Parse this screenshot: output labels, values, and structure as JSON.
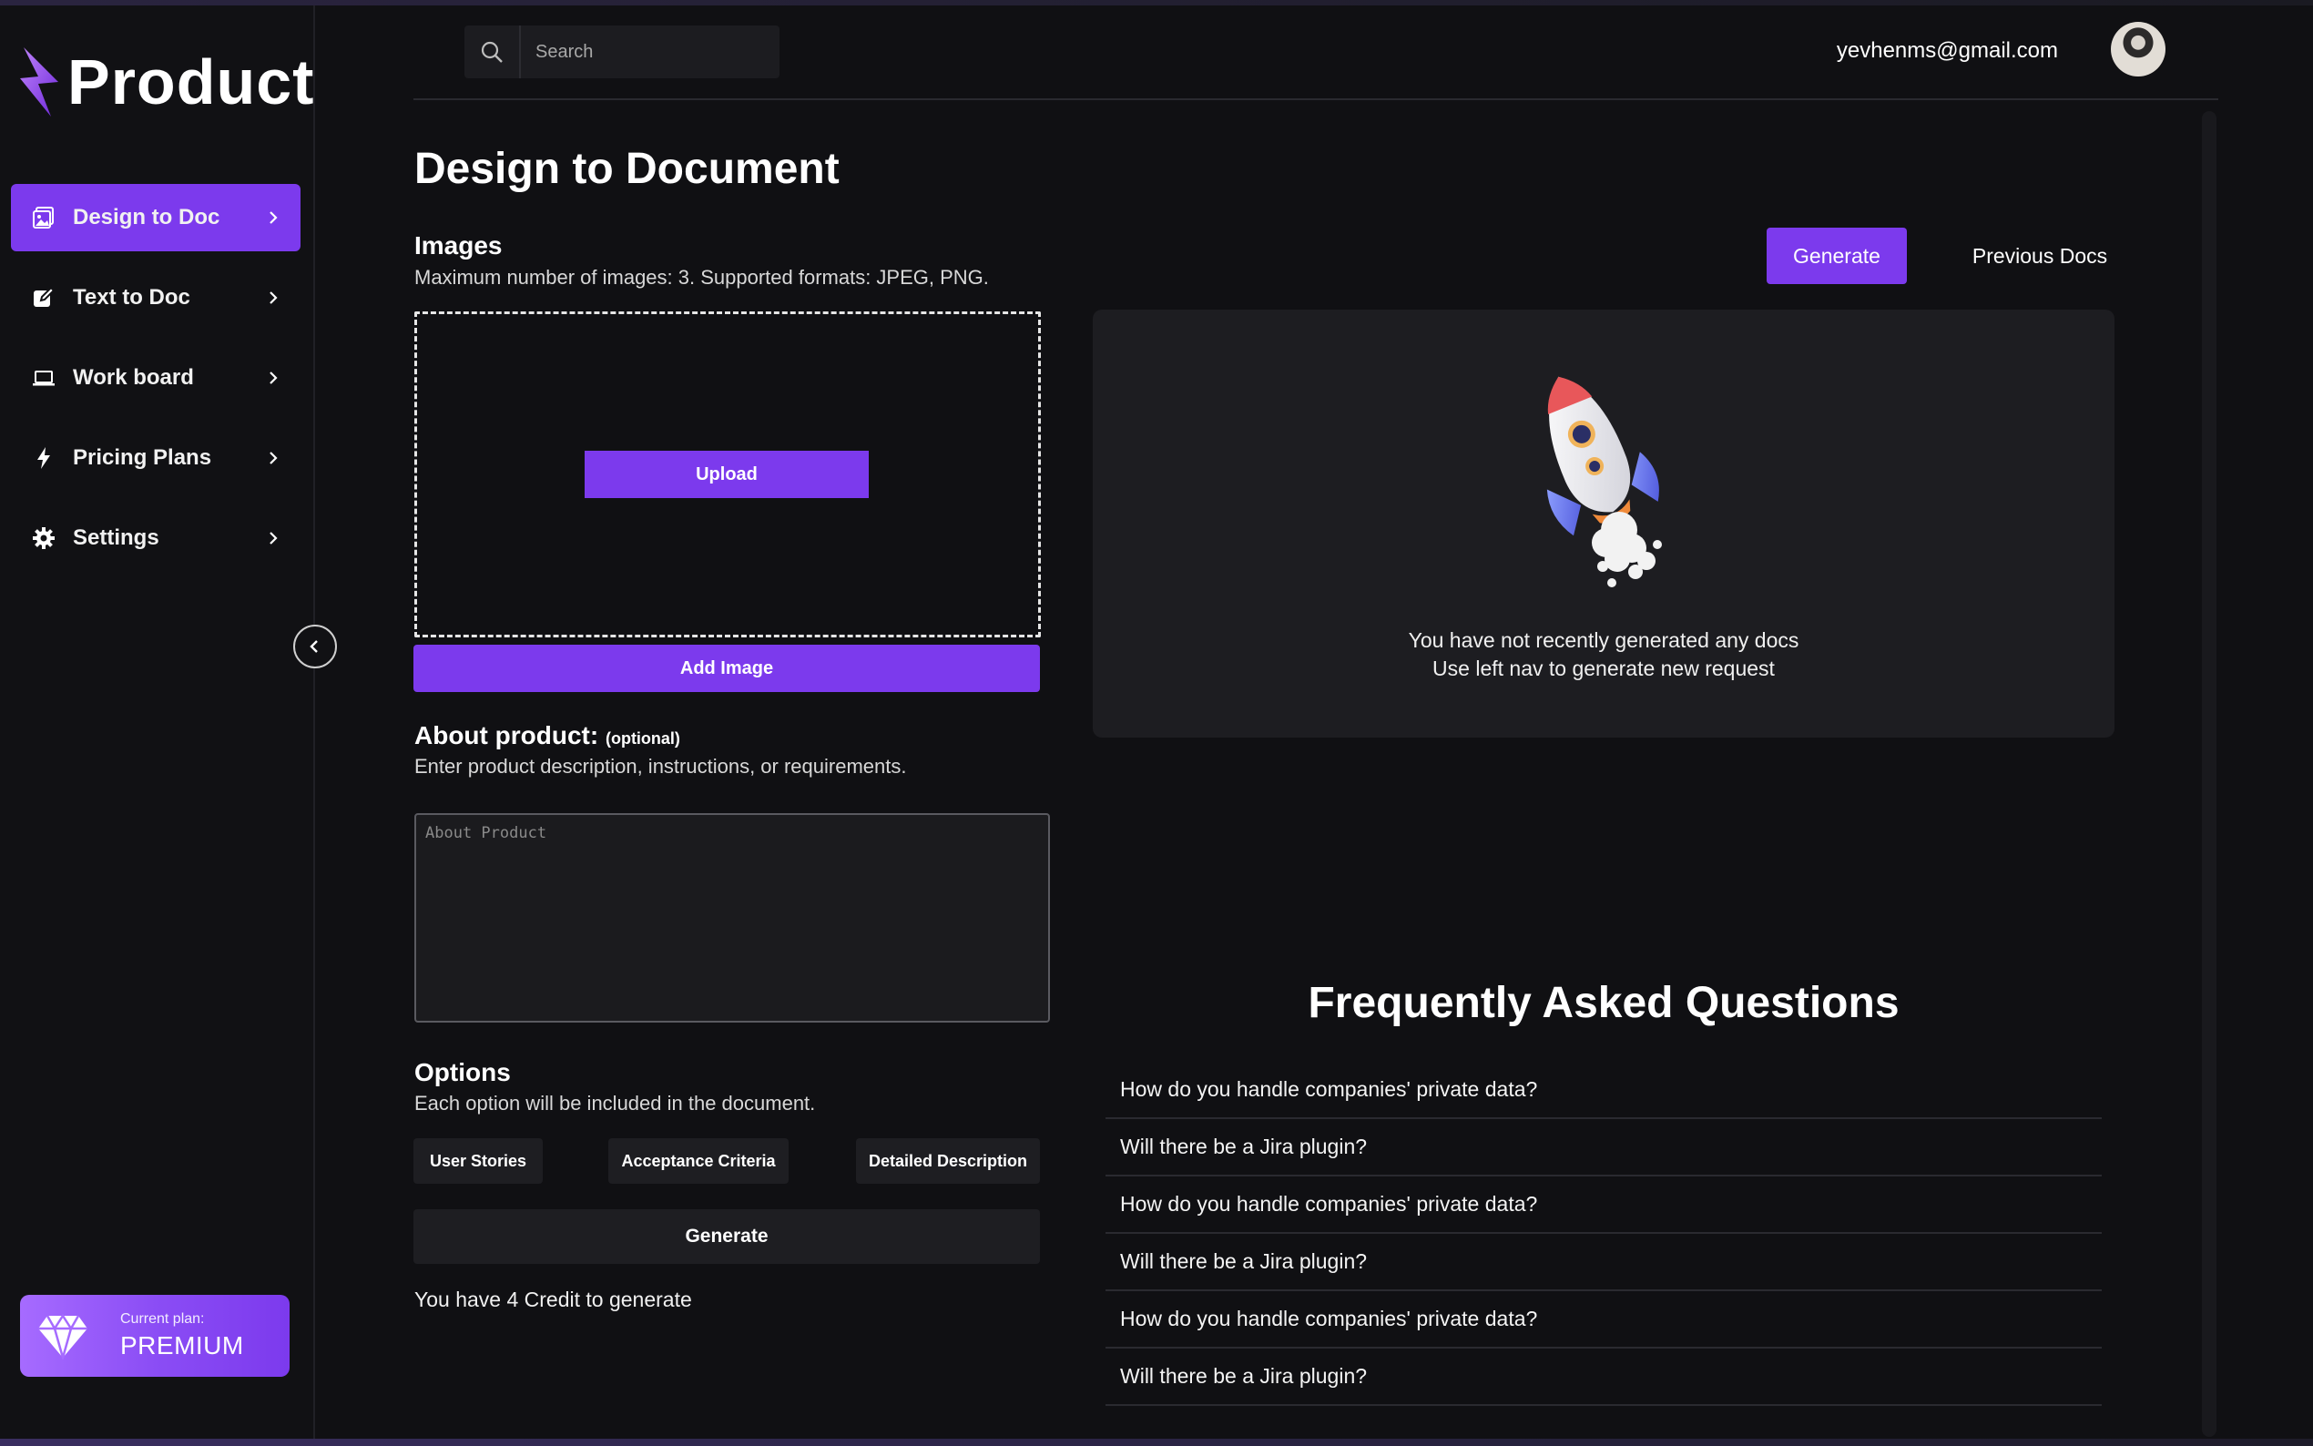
{
  "brand": {
    "name": "Product",
    "accent": "#7c3aed"
  },
  "header": {
    "search_placeholder": "Search",
    "user_email": "yevhenms@gmail.com"
  },
  "sidebar": {
    "items": [
      {
        "label": "Design to Doc",
        "icon": "image-doc-icon",
        "active": true
      },
      {
        "label": "Text to Doc",
        "icon": "edit-icon",
        "active": false
      },
      {
        "label": "Work board",
        "icon": "laptop-icon",
        "active": false
      },
      {
        "label": "Pricing Plans",
        "icon": "bolt-icon",
        "active": false
      },
      {
        "label": "Settings",
        "icon": "gear-icon",
        "active": false
      }
    ],
    "plan": {
      "caption": "Current plan:",
      "name": "PREMIUM"
    }
  },
  "main": {
    "title": "Design to Document",
    "images": {
      "title": "Images",
      "subtitle": "Maximum number of images: 3. Supported formats: JPEG, PNG.",
      "upload_label": "Upload",
      "add_image_label": "Add Image"
    },
    "about": {
      "title": "About product:",
      "optional": "(optional)",
      "subtitle": "Enter product description, instructions, or requirements.",
      "placeholder": "About Product",
      "value": ""
    },
    "options": {
      "title": "Options",
      "subtitle": "Each option will be included in the document.",
      "chips": [
        "User Stories",
        "Acceptance Criteria",
        "Detailed Description"
      ]
    },
    "generate_label": "Generate",
    "credits_text": "You have 4 Credit to generate"
  },
  "right": {
    "generate_label": "Generate",
    "previous_docs_label": "Previous Docs",
    "empty_line1": "You have not recently generated any docs",
    "empty_line2": "Use left nav to generate new request",
    "faq_title": "Frequently Asked Questions",
    "faq": [
      "How do you handle companies' private data?",
      "Will there be a Jira plugin?",
      "How do you handle companies' private data?",
      "Will there be a Jira plugin?",
      "How do you handle companies' private data?",
      "Will there be a Jira plugin?"
    ]
  }
}
